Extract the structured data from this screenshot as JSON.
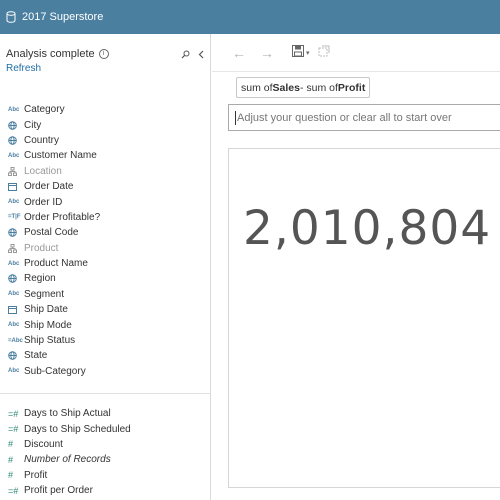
{
  "app": {
    "title": "2017 Superstore",
    "db_icon": "database-icon"
  },
  "sidebar": {
    "status": "Analysis complete",
    "refresh_label": "Refresh",
    "dimensions": [
      {
        "label": "Category",
        "type": "Abc"
      },
      {
        "label": "City",
        "type": "globe"
      },
      {
        "label": "Country",
        "type": "globe"
      },
      {
        "label": "Customer Name",
        "type": "Abc"
      },
      {
        "label": "Location",
        "type": "hierarchy",
        "dim": true
      },
      {
        "label": "Order Date",
        "type": "date"
      },
      {
        "label": "Order ID",
        "type": "Abc"
      },
      {
        "label": "Order Profitable?",
        "type": "=T|F"
      },
      {
        "label": "Postal Code",
        "type": "globe"
      },
      {
        "label": "Product",
        "type": "hierarchy",
        "dim": true
      },
      {
        "label": "Product Name",
        "type": "Abc"
      },
      {
        "label": "Region",
        "type": "globe"
      },
      {
        "label": "Segment",
        "type": "Abc"
      },
      {
        "label": "Ship Date",
        "type": "date"
      },
      {
        "label": "Ship Mode",
        "type": "Abc"
      },
      {
        "label": "Ship Status",
        "type": "=Abc"
      },
      {
        "label": "State",
        "type": "globe"
      },
      {
        "label": "Sub-Category",
        "type": "Abc"
      }
    ],
    "measures": [
      {
        "label": "Days to Ship Actual",
        "type": "=#"
      },
      {
        "label": "Days to Ship Scheduled",
        "type": "=#"
      },
      {
        "label": "Discount",
        "type": "#"
      },
      {
        "label": "Number of Records",
        "type": "#",
        "italic": true
      },
      {
        "label": "Profit",
        "type": "#"
      },
      {
        "label": "Profit per Order",
        "type": "=#"
      }
    ]
  },
  "query": {
    "pill_prefix": "sum of ",
    "pill_field1": "Sales",
    "pill_mid": " - sum of ",
    "pill_field2": "Profit",
    "placeholder": "Adjust your question or clear all to start over"
  },
  "result": {
    "value": "2,010,804"
  }
}
